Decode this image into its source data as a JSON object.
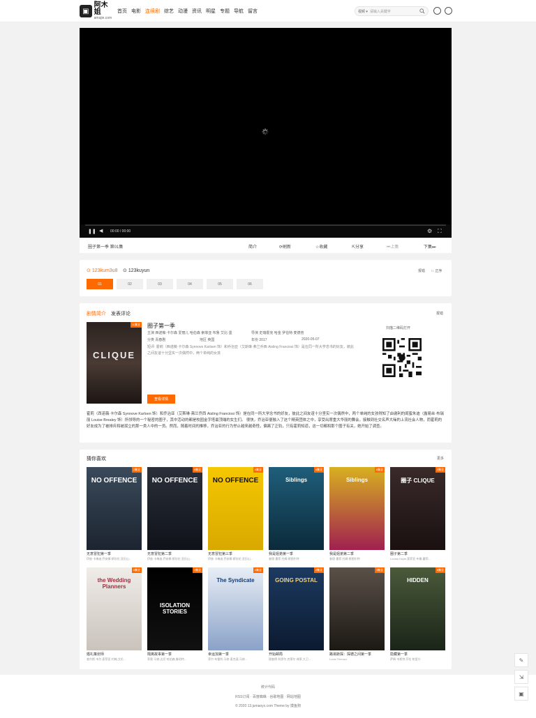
{
  "header": {
    "logo_main": "阿木姐",
    "logo_sub": "amujie.com",
    "nav": [
      "首页",
      "电影",
      "连续剧",
      "综艺",
      "动漫",
      "资讯",
      "明星",
      "专题",
      "导航",
      "留言"
    ],
    "active_nav": "连续剧",
    "search": {
      "select": "视频",
      "placeholder": "请输入关键字"
    }
  },
  "player": {
    "time": "00:00 / 00:00"
  },
  "infobar": {
    "title": "圈子第一季  第01集",
    "actions": [
      "简介",
      "刷新",
      "收藏",
      "分享",
      "上集",
      "下集"
    ]
  },
  "sources": {
    "tabs": [
      "123kum3u8",
      "123kuyun"
    ],
    "right": [
      "报错",
      "↑↓ 正序"
    ],
    "episodes": [
      "01",
      "02",
      "03",
      "04",
      "05",
      "06"
    ],
    "active_episode": "01"
  },
  "detail": {
    "tabs": [
      "剧情简介",
      "发表评论"
    ],
    "report": "报错",
    "poster_title": "CLIQUE",
    "poster_tag": "31集全",
    "title": "圈子第一季",
    "cast": "主演  西诺薇·卡尔森 爱丽儿 哈伯森 索菲亚 布鲁 艾比·墨",
    "director": "导演  史瑞霍克 哈金 罗伯特 麦德普",
    "category": "分类  青春剧",
    "region": "地区  英国",
    "year": "年份  2017",
    "date": "2020-05-07",
    "short": "短评: 霍莉（西诺薇·卡尔森 Synnove Karlsen 饰）和乔治亚（艾斯琳·弗兰乔西 Aisling Franciosi 饰）是在同一所大学念书的好友，彼此之间友谊十分坚实一次偶然中，两个单纯的女孩",
    "button": "查看详情",
    "qr_label": "扫描二维码打开",
    "synopsis": "霍莉（西诺薇·卡尔森 Synnove Karlsen 饰）和乔治亚（艾斯琳·弗兰乔西 Aisling Franciosi 饰）是在同一所大学念书的好友，彼此之间友谊十分坚实一次偶然中，两个单纯的女孩得知了由谢利的闺蜜朱迪（露易丝·布瑞丽 Louise Brealey 饰）所领导的一个秘密的圈子，其中活动的都是校园金字塔最顶端的女生们。    很快，乔治亚便融入了这个精英团体之中，享受出席重大华丽的舞会，接触到社交名声大噪的上流社会人物，而霍莉的好友成为了被排斥和被孤立的那一类人中的一员。然而，随着时间的推移，乔治亚的行为举止越来越奇怪，偏离了正轨，只有霍莉知道，这一切都和那个圈子有关，她开始了调查。"
  },
  "recommend": {
    "title": "猜你喜欢",
    "more": "更多",
    "items": [
      {
        "poster": "NO OFFENCE",
        "tag": "2集全",
        "title": "无意冒犯第一季",
        "sub": "伊兹·卡梅迪,乔安娜·斯坎伦,亚历山..."
      },
      {
        "poster": "NO OFFENCE",
        "tag": "8集全",
        "title": "无意冒犯第二季",
        "sub": "伊兹·卡梅迪,乔安娜·斯坎伦,亚历山..."
      },
      {
        "poster": "NO OFFENCE",
        "tag": "6集全",
        "title": "无意冒犯第三季",
        "sub": "伊兹·卡梅迪,乔安娜·斯坎伦,亚历山..."
      },
      {
        "poster": "Siblings",
        "tag": "6集全",
        "title": "我是姐弟第一季",
        "sub": "查理·墨菲,托姆·斯图尔特"
      },
      {
        "poster": "Siblings",
        "tag": "6集全",
        "title": "我是姐弟第二季",
        "sub": "查理·墨菲,托姆·斯图尔特"
      },
      {
        "poster": "圈子 CLIQUE",
        "tag": "2集全",
        "title": "圈子第二季",
        "sub": "Louisa Hoyle,索菲亚·布鲁,霍莉..."
      },
      {
        "poster": "the Wedding Planners",
        "tag": "6集全",
        "title": "婚礼策划师",
        "sub": "查尔斯·韦尔,索菲亚·约翰,艾伦..."
      },
      {
        "poster": "ISOLATION STORIES",
        "tag": "4集全",
        "title": "隔离故事第一季",
        "sub": "菲奥·马修,达尼·哈伯森,鲁珀特..."
      },
      {
        "poster": "The Syndicate",
        "tag": "6集全",
        "title": "幸运加第一季",
        "sub": "菲尔·布雷利,马修·麦克斐,马修..."
      },
      {
        "poster": "GOING POSTAL",
        "tag": "2集全",
        "title": "开始邮局",
        "sub": "理查德·科伊尔,克莱尔·弗莱,大卫..."
      },
      {
        "poster": "",
        "tag": "3集全",
        "title": "路易斯探：探德之间第一季",
        "sub": "Louis Theroux"
      },
      {
        "poster": "HIDDEN",
        "tag": "6集全",
        "title": "隐藏第一季",
        "sub": "萨姆·韦斯特,莎拉·帕里什"
      }
    ]
  },
  "footer": {
    "line1": "统计代码",
    "links": [
      "RSS订阅",
      "百度蜘蛛",
      "谷歌地图",
      "网站地图"
    ],
    "copy": "© 2020 13.jumaoyx.com Theme by 摸鱼狗"
  },
  "colors": {
    "accent": "#ff6a00"
  }
}
